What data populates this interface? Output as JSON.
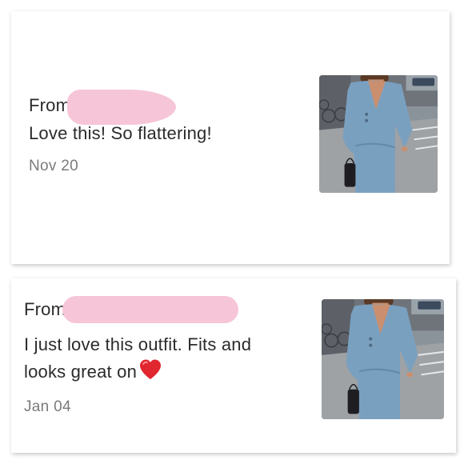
{
  "comments": [
    {
      "from_label": "From",
      "message": "Love this! So flattering!",
      "date": "Nov 20",
      "thumbnail_icon": "outfit-photo"
    },
    {
      "from_label": "From",
      "message": "I just love this outfit. Fits and looks great on",
      "emoji": "red-heart",
      "date": "Jan 04",
      "thumbnail_icon": "outfit-photo"
    }
  ],
  "colors": {
    "redaction": "#f6c6d8",
    "text": "#2b2b2b",
    "date": "#7a7a7a",
    "sweater": "#7aa0c0",
    "heart": "#e0262f"
  }
}
